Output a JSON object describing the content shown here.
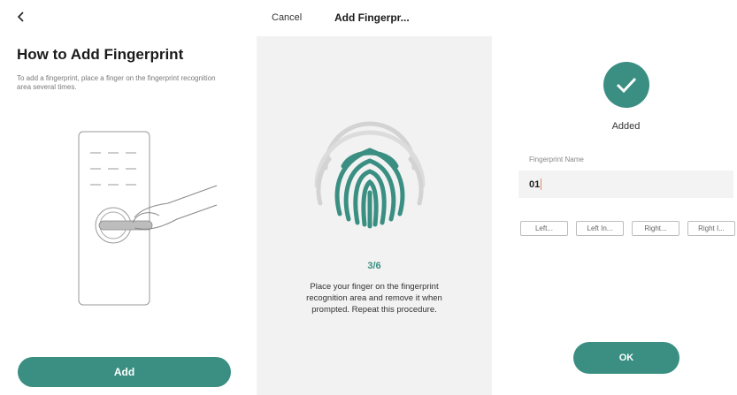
{
  "guide": {
    "title": "How to Add Fingerprint",
    "description": "To add a fingerprint, place a finger on the fingerprint recognition area several times.",
    "add_label": "Add"
  },
  "enroll": {
    "cancel_label": "Cancel",
    "title": "Add Fingerpr...",
    "progress": "3/6",
    "instructions": "Place your finger on the fingerprint recognition area and remove it when prompted. Repeat this procedure."
  },
  "result": {
    "status": "Added",
    "name_label": "Fingerprint Name",
    "name_value": "01",
    "chips": [
      "Left...",
      "Left In...",
      "Right...",
      "Right I..."
    ],
    "ok_label": "OK"
  },
  "colors": {
    "accent": "#3a8f82",
    "field_bg": "#f3f3f3",
    "panel_gray": "#f2f2f2"
  },
  "icons": [
    "back-arrow-icon",
    "fingerprint-icon",
    "checkmark-icon",
    "door-lock-illustration"
  ]
}
